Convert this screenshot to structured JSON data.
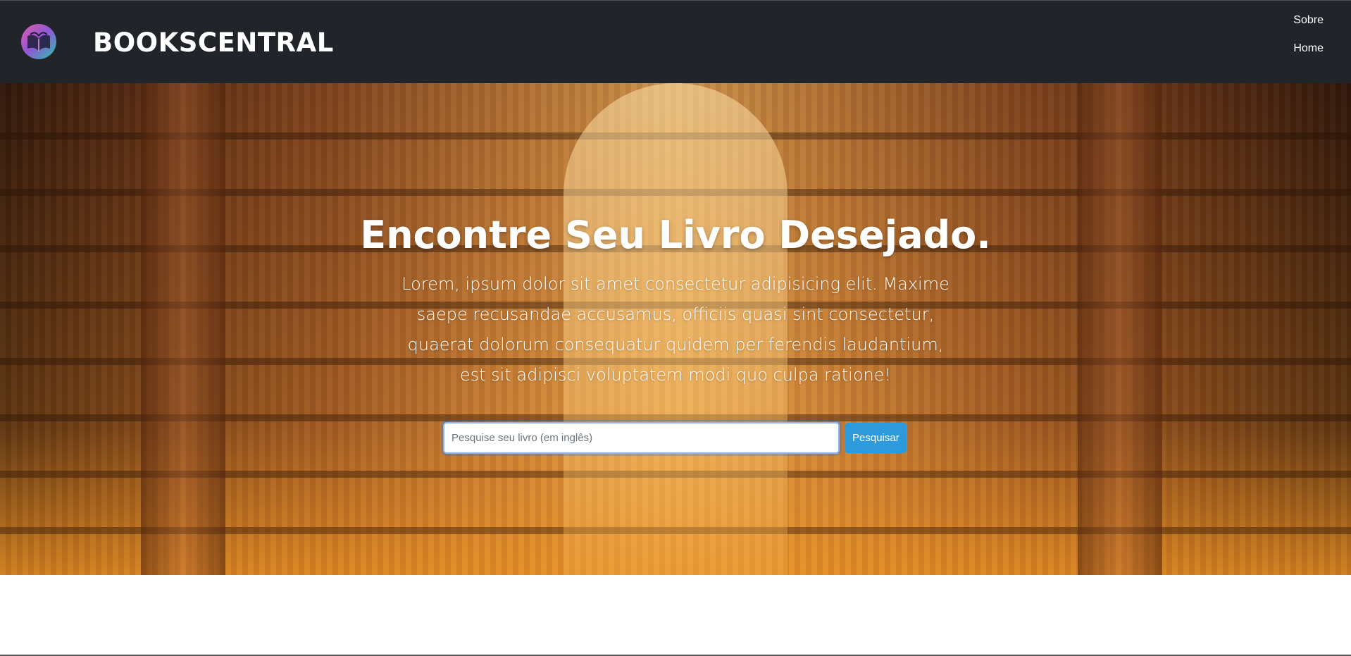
{
  "header": {
    "brand": "BOOKSCENTRAL",
    "logo_icon": "open-book-logo-icon",
    "nav": [
      {
        "label": "Sobre"
      },
      {
        "label": "Home"
      }
    ]
  },
  "hero": {
    "title": "Encontre Seu Livro Desejado.",
    "text": "Lorem, ipsum dolor sit amet consectetur adipisicing elit. Maxime saepe recusandae accusamus, officiis quasi sint consectetur, quaerat dolorum consequatur quidem per ferendis laudantium, est sit adipisci voluptatem modi quo culpa ratione!",
    "background": "library-bookshelves-image"
  },
  "search": {
    "value": "",
    "placeholder": "Pesquise seu livro (em inglês)",
    "button_label": "Pesquisar"
  },
  "colors": {
    "navbar": "#212529",
    "button": "#2d9bdb",
    "hero_glow": "#eb9123"
  }
}
